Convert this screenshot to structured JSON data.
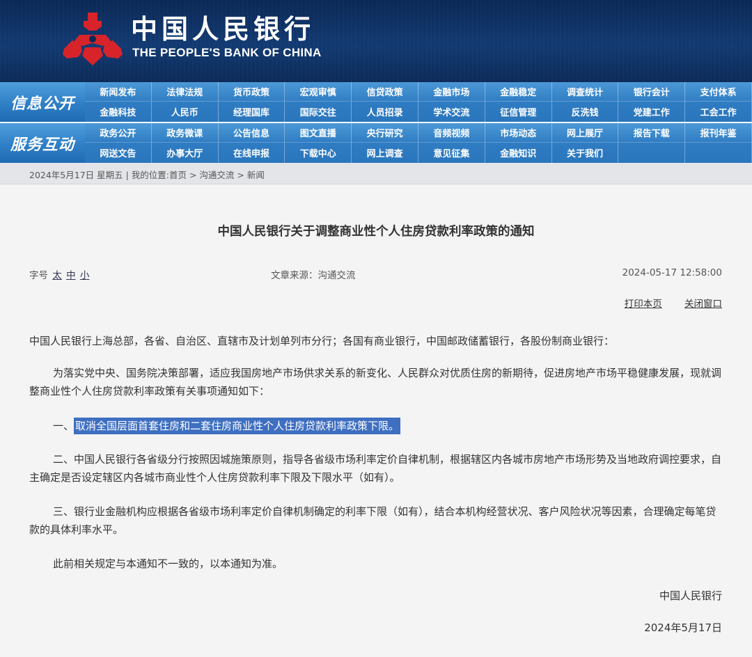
{
  "header": {
    "bank_name_cn": "中国人民银行",
    "bank_name_en": "THE PEOPLE'S BANK OF CHINA",
    "logo_icon": "pboc-emblem-icon",
    "colors": {
      "banner": "#123a72",
      "emblem": "#d7242b",
      "nav": "#2f7cc3"
    }
  },
  "nav": {
    "info_label": "信息公开",
    "info_items": [
      "新闻发布",
      "法律法规",
      "货币政策",
      "宏观审慎",
      "信贷政策",
      "金融市场",
      "金融稳定",
      "调查统计",
      "银行会计",
      "支付体系",
      "金融科技",
      "人民币",
      "经理国库",
      "国际交往",
      "人员招录",
      "学术交流",
      "征信管理",
      "反洗钱",
      "党建工作",
      "工会工作"
    ],
    "service_label": "服务互动",
    "service_items": [
      "政务公开",
      "政务微课",
      "公告信息",
      "图文直播",
      "央行研究",
      "音频视频",
      "市场动态",
      "网上展厅",
      "报告下载",
      "报刊年鉴",
      "网送文告",
      "办事大厅",
      "在线申报",
      "下载中心",
      "网上调查",
      "意见征集",
      "金融知识",
      "关于我们",
      "",
      ""
    ]
  },
  "breadcrumb": "2024年5月17日  星期五 | 我的位置:首页 > 沟通交流 > 新闻",
  "article": {
    "title": "中国人民银行关于调整商业性个人住房贷款利率政策的通知",
    "font_label": "字号",
    "font_large": "太",
    "font_medium": "中",
    "font_small": "小",
    "source": "文章来源：沟通交流",
    "datetime": "2024-05-17 12:58:00",
    "print_label": "打印本页",
    "close_label": "关闭窗口",
    "recipients": "中国人民银行上海总部，各省、自治区、直辖市及计划单列市分行；各国有商业银行，中国邮政储蓄银行，各股份制商业银行：",
    "intro": "为落实党中央、国务院决策部署，适应我国房地产市场供求关系的新变化、人民群众对优质住房的新期待，促进房地产市场平稳健康发展，现就调整商业性个人住房贷款利率政策有关事项通知如下：",
    "item1_prefix": "一、",
    "item1_text": "取消全国层面首套住房和二套住房商业性个人住房贷款利率政策下限。",
    "item2": "二、中国人民银行各省级分行按照因城施策原则，指导各省级市场利率定价自律机制，根据辖区内各城市房地产市场形势及当地政府调控要求，自主确定是否设定辖区内各城市商业性个人住房贷款利率下限及下限水平（如有）。",
    "item3": "三、银行业金融机构应根据各省级市场利率定价自律机制确定的利率下限（如有），结合本机构经营状况、客户风险状况等因素，合理确定每笔贷款的具体利率水平。",
    "closing": "此前相关规定与本通知不一致的，以本通知为准。",
    "signature": "中国人民银行",
    "sign_date": "2024年5月17日"
  }
}
